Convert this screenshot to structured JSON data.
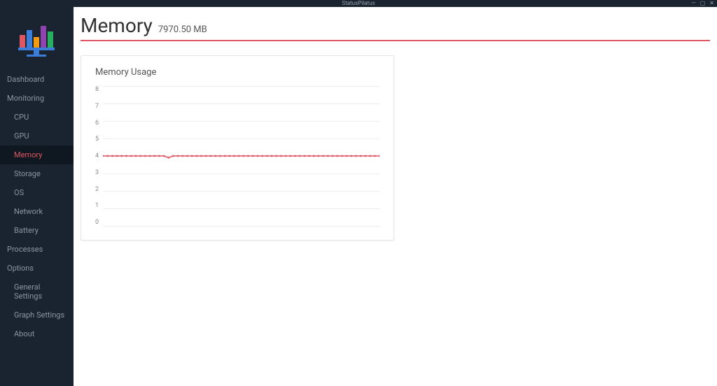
{
  "titlebar": {
    "title": "StatusPilatus"
  },
  "sidebar": {
    "dashboard": "Dashboard",
    "monitoring": {
      "label": "Monitoring",
      "items": [
        {
          "label": "CPU"
        },
        {
          "label": "GPU"
        },
        {
          "label": "Memory",
          "active": true
        },
        {
          "label": "Storage"
        },
        {
          "label": "OS"
        },
        {
          "label": "Network"
        },
        {
          "label": "Battery"
        }
      ]
    },
    "processes": "Processes",
    "options": {
      "label": "Options",
      "items": [
        {
          "label": "General Settings"
        },
        {
          "label": "Graph Settings"
        },
        {
          "label": "About"
        }
      ]
    }
  },
  "page": {
    "title": "Memory",
    "subtitle": "7970.50 MB"
  },
  "card": {
    "title": "Memory Usage"
  },
  "colors": {
    "accent": "#de5763",
    "grid": "#eeeeee",
    "sidebar_bg": "#1a2430"
  },
  "chart_data": {
    "type": "line",
    "title": "Memory Usage",
    "xlabel": "",
    "ylabel": "",
    "ylim": [
      0,
      8
    ],
    "y_ticks": [
      0,
      1,
      2,
      3,
      4,
      5,
      6,
      7,
      8
    ],
    "series": [
      {
        "name": "Memory",
        "color": "#de5763",
        "values": [
          4.0,
          4.0,
          4.0,
          4.0,
          4.0,
          4.0,
          4.0,
          4.0,
          4.0,
          4.0,
          4.0,
          4.0,
          4.0,
          4.0,
          3.9,
          4.0,
          4.0,
          4.0,
          4.0,
          4.0,
          4.0,
          4.0,
          4.0,
          4.0,
          4.0,
          4.0,
          4.0,
          4.0,
          4.0,
          4.0,
          4.0,
          4.0,
          4.0,
          4.0,
          4.0,
          4.0,
          4.0,
          4.0,
          4.0,
          4.0,
          4.0,
          4.0,
          4.0,
          4.0,
          4.0,
          4.0,
          4.0,
          4.0,
          4.0,
          4.0,
          4.0,
          4.0,
          4.0,
          4.0,
          4.0,
          4.0,
          4.0,
          4.0,
          4.0,
          4.0
        ]
      }
    ]
  }
}
